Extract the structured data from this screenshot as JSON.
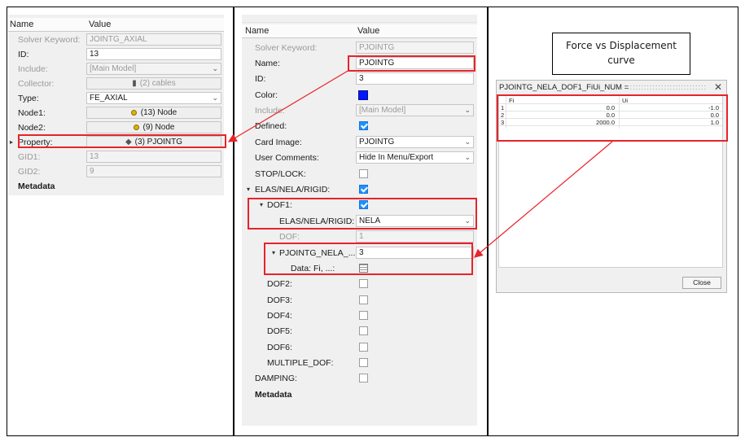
{
  "left_panel": {
    "col_name": "Name",
    "col_value": "Value",
    "rows": [
      {
        "label": "Solver Keyword:",
        "value": "JOINTG_AXIAL"
      },
      {
        "label": "ID:",
        "value": "13"
      },
      {
        "label": "Include:",
        "value": "[Main Model]"
      },
      {
        "label": "Collector:",
        "value": "(2) cables"
      },
      {
        "label": "Type:",
        "value": "FE_AXIAL"
      },
      {
        "label": "Node1:",
        "value": "(13) Node"
      },
      {
        "label": "Node2:",
        "value": "(9) Node"
      },
      {
        "label": "Property:",
        "value": "(3) PJOINTG"
      },
      {
        "label": "GID1:",
        "value": "13"
      },
      {
        "label": "GID2:",
        "value": "9"
      }
    ],
    "metadata": "Metadata"
  },
  "mid_panel": {
    "col_name": "Name",
    "col_value": "Value",
    "rows": [
      {
        "label": "Solver Keyword:",
        "value": "PJOINTG"
      },
      {
        "label": "Name:",
        "value": "PJOINTG"
      },
      {
        "label": "ID:",
        "value": "3"
      },
      {
        "label": "Color:",
        "value": ""
      },
      {
        "label": "Include:",
        "value": "[Main Model]"
      },
      {
        "label": "Defined:",
        "value": ""
      },
      {
        "label": "Card Image:",
        "value": "PJOINTG"
      },
      {
        "label": "User Comments:",
        "value": "Hide In Menu/Export"
      },
      {
        "label": "STOP/LOCK:",
        "value": ""
      },
      {
        "label": "ELAS/NELA/RIGID:",
        "value": ""
      },
      {
        "label": "DOF1:",
        "value": ""
      },
      {
        "label": "ELAS/NELA/RIGID:",
        "value": "NELA"
      },
      {
        "label": "DOF:",
        "value": "1"
      },
      {
        "label": "PJOINTG_NELA_...",
        "value": "3"
      },
      {
        "label": "Data: Fi, ...:",
        "value": ""
      },
      {
        "label": "DOF2:",
        "value": ""
      },
      {
        "label": "DOF3:",
        "value": ""
      },
      {
        "label": "DOF4:",
        "value": ""
      },
      {
        "label": "DOF5:",
        "value": ""
      },
      {
        "label": "DOF6:",
        "value": ""
      },
      {
        "label": "MULTIPLE_DOF:",
        "value": ""
      },
      {
        "label": "DAMPING:",
        "value": ""
      }
    ],
    "metadata": "Metadata",
    "colors": {
      "color_swatch": "#0018ff",
      "checkbox": "#1e90ff"
    }
  },
  "callout": {
    "line1": "Force vs Displacement",
    "line2": "curve"
  },
  "dialog": {
    "title": "PJOINTG_NELA_DOF1_FiUi_NUM =",
    "columns": [
      "Fi",
      "Ui"
    ],
    "rows": [
      {
        "index": "1",
        "fi": "0.0",
        "ui": "-1.0"
      },
      {
        "index": "2",
        "fi": "0.0",
        "ui": "0.0"
      },
      {
        "index": "3",
        "fi": "2000.0",
        "ui": "1.0"
      }
    ],
    "close_label": "Close"
  },
  "highlight_color": "#e8232a"
}
